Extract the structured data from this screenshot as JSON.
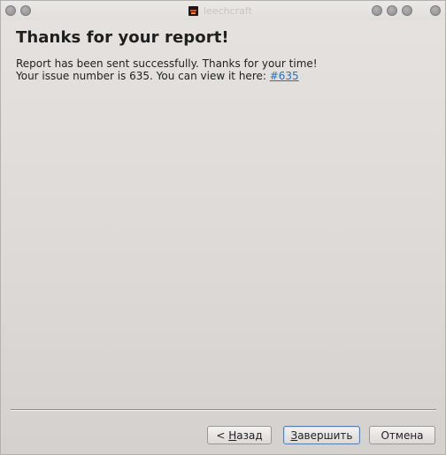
{
  "window": {
    "title": "leechcraft"
  },
  "content": {
    "heading": "Thanks for your report!",
    "line1": "Report has been sent successfully. Thanks for your time!",
    "line2_prefix": "Your issue number is 635. You can view it here: ",
    "issue_link": "#635"
  },
  "buttons": {
    "back_prefix": "< ",
    "back_mnemonic": "Н",
    "back_rest": "азад",
    "finish_mnemonic": "З",
    "finish_rest": "авершить",
    "cancel": "Отмена"
  },
  "colors": {
    "link": "#2a6fb6",
    "window_bg": "#dcd9d6",
    "default_button_border": "#5a7fa8"
  },
  "icons": {
    "titlebar_left": [
      "menu-circle-icon",
      "sticky-circle-icon"
    ],
    "titlebar_right": [
      "minimize-circle-icon",
      "maximize-circle-icon",
      "close-circle-icon"
    ],
    "app": "leechcraft-app-icon"
  }
}
